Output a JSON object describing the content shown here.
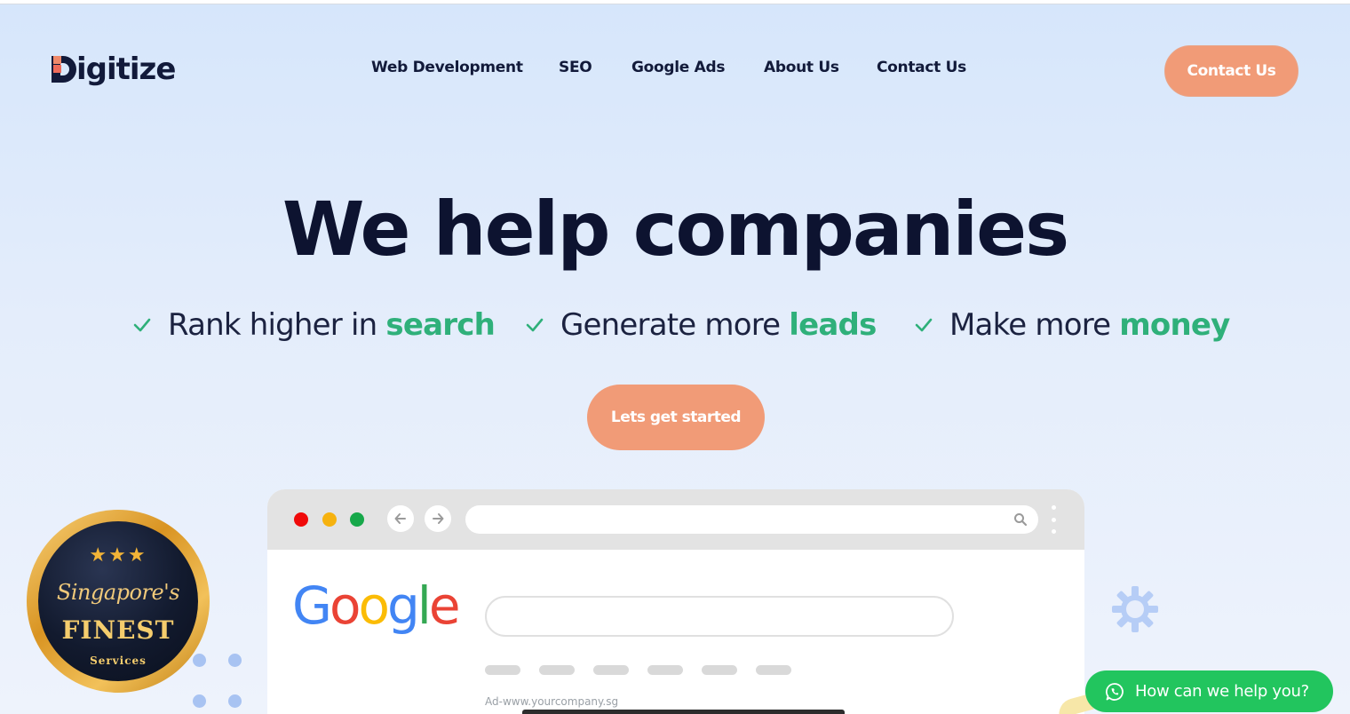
{
  "header": {
    "logo_text": "igitize",
    "nav": [
      {
        "label": "Web Development"
      },
      {
        "label": "SEO"
      },
      {
        "label": "Google Ads"
      },
      {
        "label": "About Us"
      },
      {
        "label": "Contact Us"
      }
    ],
    "cta_label": "Contact Us"
  },
  "hero": {
    "title": "We help companies",
    "benefits": [
      {
        "text": "Rank higher in ",
        "highlight": "search"
      },
      {
        "text": "Generate more ",
        "highlight": "leads"
      },
      {
        "text": "Make more ",
        "highlight": "money"
      }
    ],
    "cta_label": "Lets get started"
  },
  "browser_mock": {
    "logo_letters": [
      "G",
      "o",
      "o",
      "g",
      "l",
      "e"
    ],
    "ad_text": "Ad-www.yourcompany.sg"
  },
  "badge": {
    "stars": "★★★",
    "line1": "Singapore's",
    "line2": "FINEST",
    "line3": "Services"
  },
  "whatsapp": {
    "label": "How can we help you?"
  },
  "colors": {
    "accent": "#f19b77",
    "highlight_green": "#2fb07a",
    "navy": "#121a3a",
    "whatsapp_green": "#22c55e"
  },
  "icons": [
    "check-icon",
    "back-arrow-icon",
    "forward-arrow-icon",
    "search-icon",
    "more-vertical-icon",
    "gear-icon",
    "whatsapp-icon"
  ]
}
